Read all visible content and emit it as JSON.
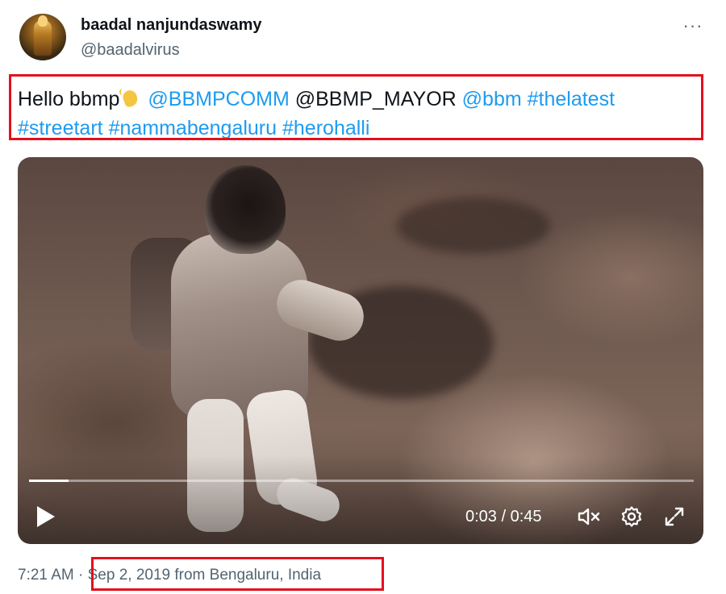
{
  "author": {
    "name": "baadal nanjundaswamy",
    "handle": "@baadalvirus"
  },
  "more_label": "···",
  "tweet": {
    "greeting": "Hello bbmp",
    "emoji_name": "waving-hand-emoji",
    "mention1": "@BBMPCOMM",
    "mention2": "@BBMP_MAYOR",
    "mention3": "@bbm",
    "hashtag1": "#thelatest",
    "hashtag2": "#streetart",
    "hashtag3": "#nammabengaluru",
    "hashtag4": "#herohalli"
  },
  "video": {
    "current_time": "0:03",
    "separator": " / ",
    "duration": "0:45",
    "progress": 0.06,
    "icons": [
      "play-icon",
      "mute-icon",
      "settings-icon",
      "fullscreen-icon"
    ]
  },
  "footer": {
    "time": "7:21 AM",
    "dot": "·",
    "date_location": "Sep 2, 2019 from Bengaluru, India"
  },
  "colors": {
    "link": "#1d9bf0",
    "highlight": "#e3101e",
    "secondary_text": "#536471"
  }
}
